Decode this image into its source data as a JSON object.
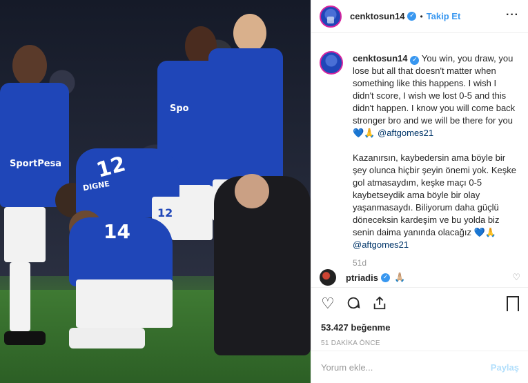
{
  "header": {
    "username": "cenktosun14",
    "separator": "•",
    "follow_label": "Takip Et",
    "more_icon": "more-options-icon"
  },
  "photo": {
    "jersey_numbers": [
      "12",
      "14",
      "12"
    ],
    "sponsor": "SportPesa",
    "sponsor_short": "Spo",
    "player_name": "DIGNE"
  },
  "caption": {
    "username": "cenktosun14",
    "text_en": "You win, you draw, you lose but all that doesn't matter when something like this happens. I wish I didn't score, I wish we lost 0-5 and this didn't happen. I know you will come back stronger bro and we will be there for you 💙🙏 ",
    "mention": "@aftgomes21",
    "text_tr": "Kazanırsın, kaybedersin ama böyle bir şey olunca hiçbir şeyin önemi yok. Keşke gol atmasaydım, keşke maçı 0-5 kaybetseydik ama böyle bir olay yaşanmasaydı. Biliyorum daha güçlü döneceksin kardeşim ve bu yolda biz senin daima yanında olacağız 💙🙏",
    "mention2": "@aftgomes21",
    "time": "51d"
  },
  "comment": {
    "username": "ptriadis",
    "text": "🙏🏼"
  },
  "actions": {
    "likes": "53.427 beğenme",
    "posted": "51 DAKİKA ÖNCE"
  },
  "add_comment": {
    "placeholder": "Yorum ekle...",
    "share_label": "Paylaş"
  }
}
